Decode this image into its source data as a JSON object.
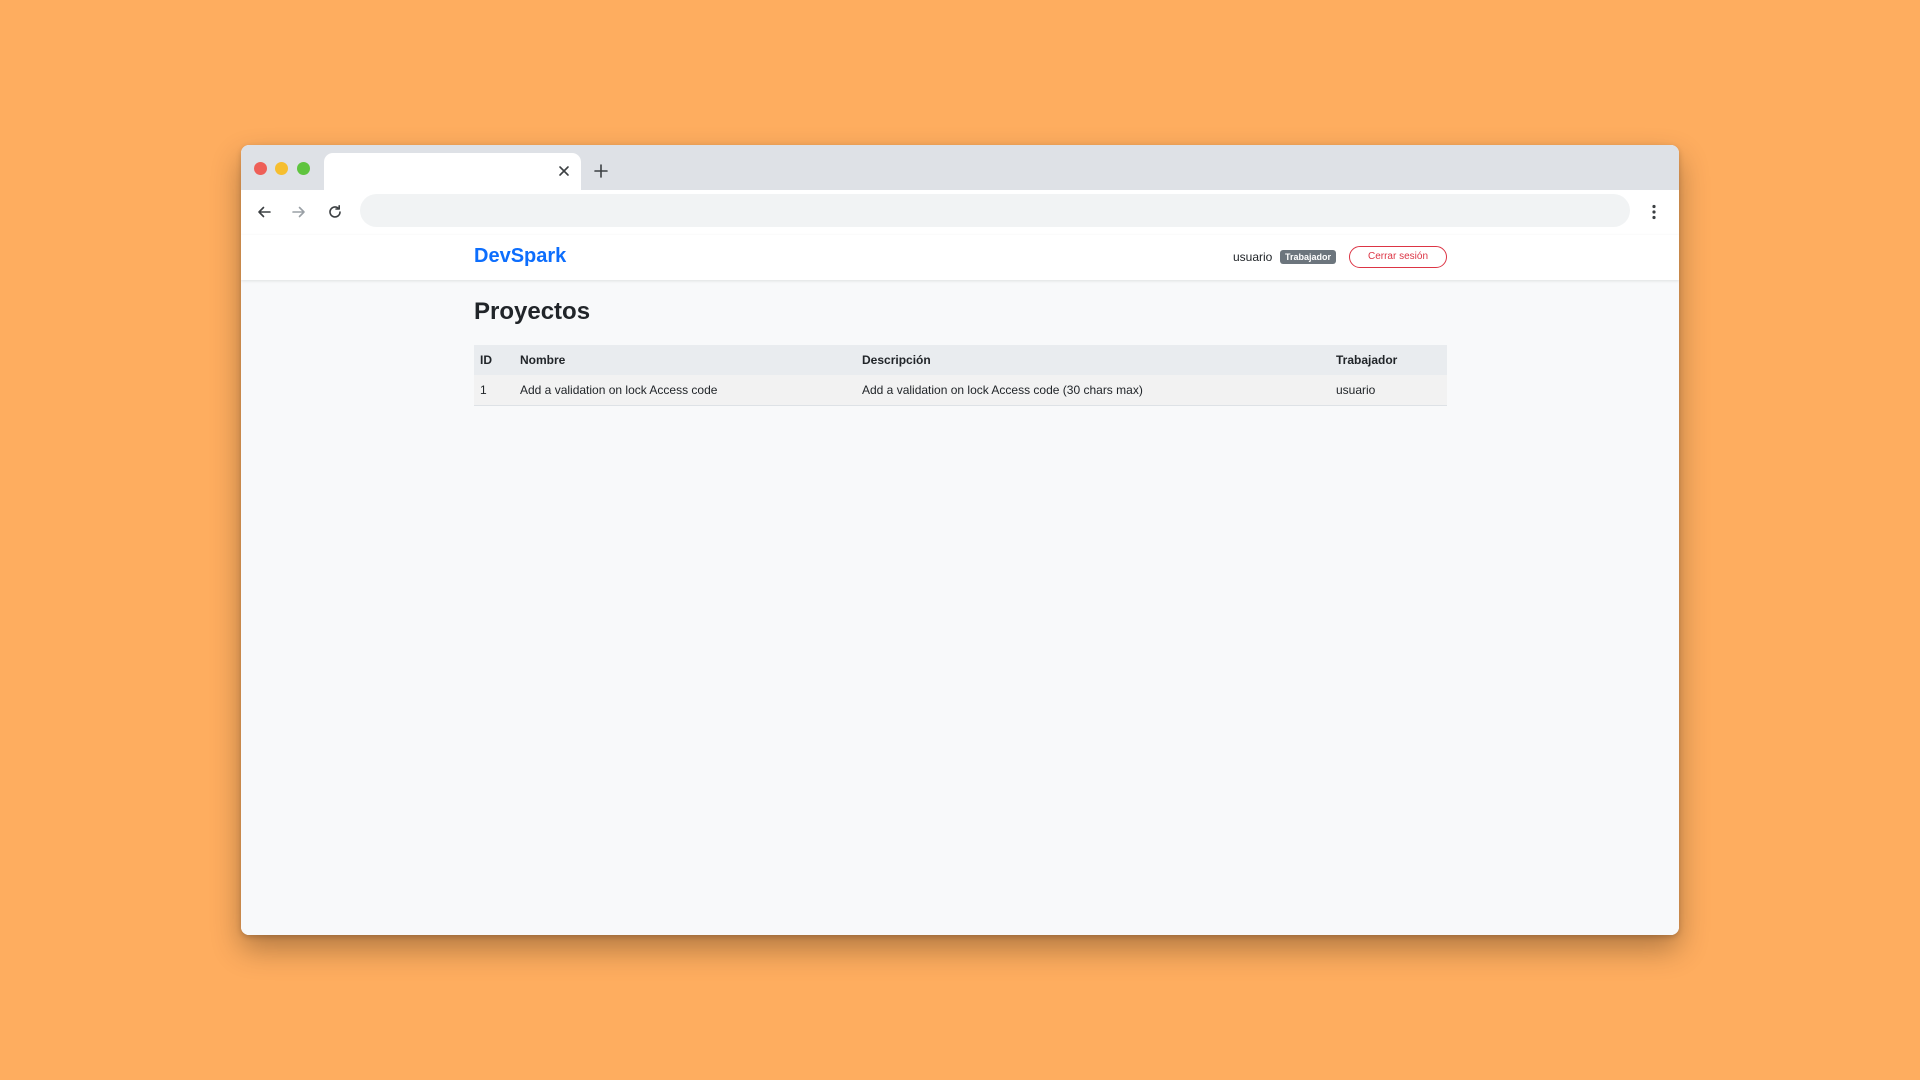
{
  "browser": {
    "tab": {
      "title": "",
      "close_icon": "close-icon"
    },
    "new_tab_icon": "plus-icon",
    "nav": {
      "back_icon": "arrow-left-icon",
      "forward_icon": "arrow-right-icon",
      "reload_icon": "reload-icon"
    },
    "address_bar": {
      "value": "",
      "placeholder": ""
    },
    "menu_icon": "kebab-menu-icon"
  },
  "app": {
    "brand": "DevSpark",
    "user": {
      "name": "usuario",
      "role": "Trabajador"
    },
    "logout_label": "Cerrar sesión",
    "page_title": "Proyectos",
    "table": {
      "headers": [
        "ID",
        "Nombre",
        "Descripción",
        "Trabajador"
      ],
      "rows": [
        [
          "1",
          "Add a validation on lock Access code",
          "Add a validation on lock Access code (30 chars max)",
          "usuario"
        ]
      ]
    }
  },
  "colors": {
    "background": "#FEAD5F",
    "brand": "#0D6EFD",
    "badge": "#6C757D",
    "danger": "#DC3545"
  }
}
